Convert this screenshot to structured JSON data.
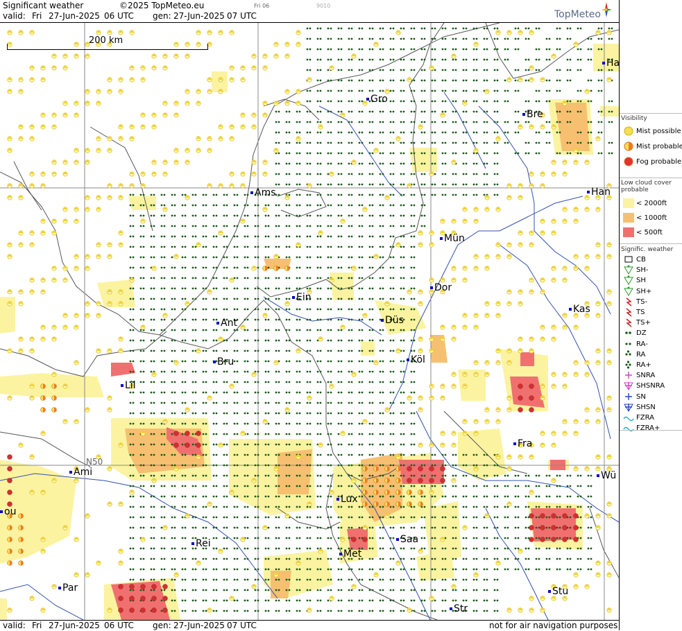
{
  "header": {
    "title": "Significant weather",
    "copyright": "©2025 TopMeteo.eu",
    "valid_label": "valid:",
    "valid_day": "Fri",
    "valid_date": "27-Jun-2025",
    "valid_time": "06 UTC",
    "gen_label": "gen:",
    "gen_date": "27-Jun-2025",
    "gen_time": "07 UTC",
    "small_tag": "Fri 06",
    "small_code": "9010",
    "logo_text": "TopMeteo"
  },
  "scale_bar": {
    "label": "200 km"
  },
  "grid_label": "N50",
  "cities": [
    {
      "name": "Gro"
    },
    {
      "name": "Ams"
    },
    {
      "name": "Bre"
    },
    {
      "name": "Han"
    },
    {
      "name": "Mün"
    },
    {
      "name": "Dor"
    },
    {
      "name": "Ein"
    },
    {
      "name": "Ant"
    },
    {
      "name": "Düs"
    },
    {
      "name": "Kas"
    },
    {
      "name": "Bru"
    },
    {
      "name": "Köl"
    },
    {
      "name": "Lil"
    },
    {
      "name": "Fra"
    },
    {
      "name": "Ami"
    },
    {
      "name": "Lux"
    },
    {
      "name": "Wü"
    },
    {
      "name": "Rei"
    },
    {
      "name": "Met"
    },
    {
      "name": "Saa"
    },
    {
      "name": "Par"
    },
    {
      "name": "Stu"
    },
    {
      "name": "Str"
    },
    {
      "name": "Ha"
    },
    {
      "name": "ou"
    }
  ],
  "footer": {
    "valid_label": "valid:",
    "valid_day": "Fri",
    "valid_date": "27-Jun-2025",
    "valid_time": "06 UTC",
    "gen_label": "gen:",
    "gen_date": "27-Jun-2025",
    "gen_time": "07 UTC",
    "disclaimer": "not for air navigation purposes"
  },
  "legend": {
    "visibility_title": "Visibility",
    "visibility": [
      {
        "label": "Mist possible",
        "color": "#f5e04a"
      },
      {
        "label": "Mist probable",
        "color": "#f07a2a"
      },
      {
        "label": "Fog probable",
        "color": "#e83030"
      }
    ],
    "cloud_title": "Low cloud cover probable",
    "cloud": [
      {
        "label": "< 2000ft",
        "color": "#fbf3a0"
      },
      {
        "label": "< 1000ft",
        "color": "#f7c070"
      },
      {
        "label": "<  500ft",
        "color": "#f07070"
      }
    ],
    "sigwx_title": "Signific. weather",
    "sigwx": [
      {
        "label": "CB",
        "icon": "cb-icon",
        "color": "#000000"
      },
      {
        "label": "SH-",
        "icon": "shower-light-icon",
        "color": "#2a9a2a"
      },
      {
        "label": "SH",
        "icon": "shower-icon",
        "color": "#2a9a2a"
      },
      {
        "label": "SH+",
        "icon": "shower-heavy-icon",
        "color": "#2a9a2a"
      },
      {
        "label": "TS-",
        "icon": "thunder-light-icon",
        "color": "#cc2222"
      },
      {
        "label": "TS",
        "icon": "thunder-icon",
        "color": "#cc2222"
      },
      {
        "label": "TS+",
        "icon": "thunder-heavy-icon",
        "color": "#cc2222"
      },
      {
        "label": "DZ",
        "icon": "drizzle-icon",
        "color": "#1a5a1a"
      },
      {
        "label": "RA-",
        "icon": "rain-light-icon",
        "color": "#1a5a1a"
      },
      {
        "label": "RA",
        "icon": "rain-icon",
        "color": "#1a5a1a"
      },
      {
        "label": "RA+",
        "icon": "rain-heavy-icon",
        "color": "#1a5a1a"
      },
      {
        "label": "SNRA",
        "icon": "sleet-icon",
        "color": "#cc44cc"
      },
      {
        "label": "SHSNRA",
        "icon": "sleet-shower-icon",
        "color": "#cc44cc"
      },
      {
        "label": "SN",
        "icon": "snow-icon",
        "color": "#2244cc"
      },
      {
        "label": "SHSN",
        "icon": "snow-shower-icon",
        "color": "#2244cc"
      },
      {
        "label": "FZRA",
        "icon": "freezing-rain-icon",
        "color": "#22aacc"
      },
      {
        "label": "FZRA+",
        "icon": "freezing-rain-heavy-icon",
        "color": "#22aacc"
      }
    ]
  }
}
